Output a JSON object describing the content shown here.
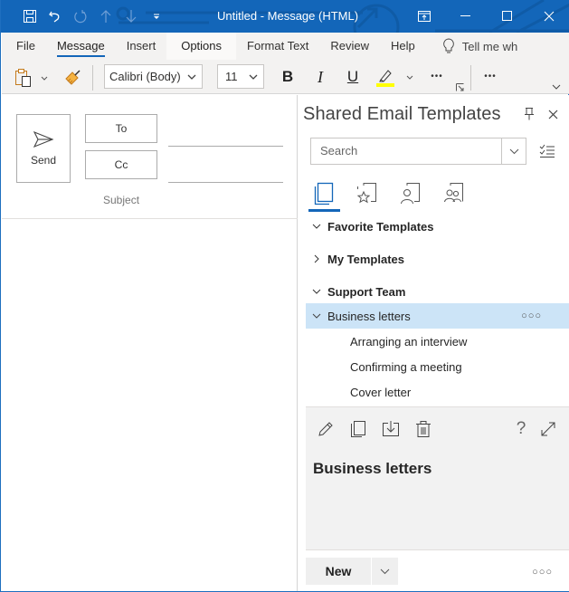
{
  "window": {
    "title": "Untitled  -  Message (HTML)",
    "title_bar_color": "#1366b9",
    "quick_access": [
      {
        "icon": "save-icon",
        "enabled": true
      },
      {
        "icon": "undo-icon",
        "enabled": true
      },
      {
        "icon": "redo-icon",
        "enabled": false
      },
      {
        "icon": "up-arrow-icon",
        "enabled": false
      },
      {
        "icon": "down-arrow-icon",
        "enabled": false
      },
      {
        "icon": "customize-qat-icon",
        "enabled": true
      }
    ],
    "controls": [
      "ribbon-display-options-icon",
      "minimize-icon",
      "maximize-icon",
      "close-icon"
    ]
  },
  "ribbon": {
    "tabs": [
      {
        "label": "File",
        "active": false
      },
      {
        "label": "Message",
        "active": true
      },
      {
        "label": "Insert",
        "active": false
      },
      {
        "label": "Options",
        "active": false
      },
      {
        "label": "Format Text",
        "active": false
      },
      {
        "label": "Review",
        "active": false
      },
      {
        "label": "Help",
        "active": false
      }
    ],
    "tell_me": "Tell me wh",
    "font_name": "Calibri (Body)",
    "font_size": "11",
    "bold_label": "B",
    "italic_label": "I",
    "underline_label": "U",
    "highlight_color": "#ffff00",
    "more_label": "•••"
  },
  "compose": {
    "send_label": "Send",
    "to_label": "To",
    "cc_label": "Cc",
    "subject_label": "Subject",
    "to_value": "",
    "cc_value": "",
    "subject_value": ""
  },
  "pane": {
    "title": "Shared Email Templates",
    "search_placeholder": "Search",
    "category_tabs": [
      {
        "icon": "all-templates-icon",
        "active": true
      },
      {
        "icon": "favorite-templates-icon",
        "active": false
      },
      {
        "icon": "my-templates-icon",
        "active": false
      },
      {
        "icon": "team-templates-icon",
        "active": false
      }
    ],
    "tree": [
      {
        "label": "Favorite Templates",
        "type": "group",
        "expanded": true
      },
      {
        "label": "My Templates",
        "type": "group",
        "expanded": false
      },
      {
        "label": "Support Team",
        "type": "group",
        "expanded": true
      },
      {
        "label": "Business letters",
        "type": "folder",
        "expanded": true,
        "selected": true,
        "more": "○○○"
      },
      {
        "label": "Arranging an interview",
        "type": "template"
      },
      {
        "label": "Confirming a meeting",
        "type": "template"
      },
      {
        "label": "Cover letter",
        "type": "template"
      }
    ],
    "preview": {
      "title": "Business letters",
      "help_label": "?"
    },
    "footer": {
      "new_label": "New",
      "more": "○○○"
    },
    "selection_color": "#cce4f7"
  }
}
